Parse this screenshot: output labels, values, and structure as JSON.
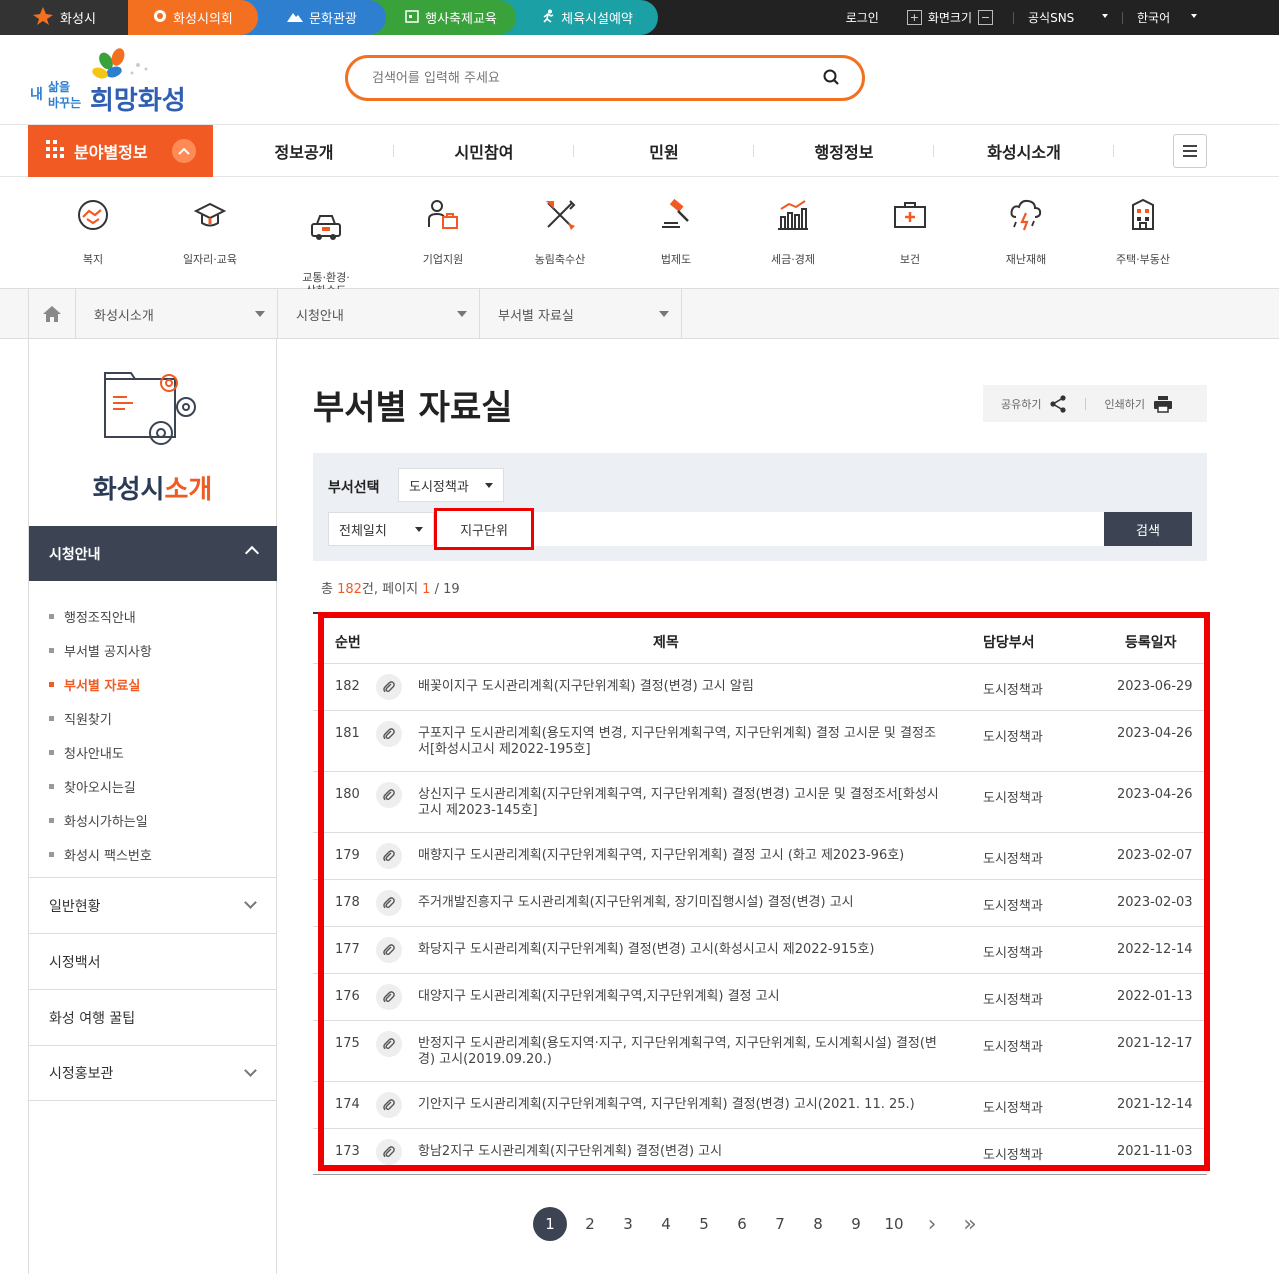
{
  "topbar": {
    "home": "화성시",
    "council": "화성시의회",
    "culture": "문화관광",
    "event": "행사축제교육",
    "sports": "체육시설예약",
    "login": "로그인",
    "zoom": "화면크기",
    "zoom_in": "+",
    "zoom_out": "−",
    "sns": "공식SNS",
    "lang": "한국어"
  },
  "header": {
    "logo_text": "내 삶을 바꾸는 희망화성",
    "search_placeholder": "검색어를 입력해 주세요"
  },
  "gnb": {
    "category_button": "분야별정보",
    "menus": [
      "정보공개",
      "시민참여",
      "민원",
      "행정정보",
      "화성시소개"
    ]
  },
  "categories": [
    {
      "label": "복지",
      "icon": "handshake-icon"
    },
    {
      "label": "일자리·교육",
      "icon": "graduation-cap-icon"
    },
    {
      "label": "교통·환경·\n상하수도",
      "icon": "car-icon"
    },
    {
      "label": "기업지원",
      "icon": "business-person-icon"
    },
    {
      "label": "농림축수산",
      "icon": "farming-tools-icon"
    },
    {
      "label": "법제도",
      "icon": "gavel-icon"
    },
    {
      "label": "세금·경제",
      "icon": "bar-chart-icon"
    },
    {
      "label": "보건",
      "icon": "first-aid-icon"
    },
    {
      "label": "재난재해",
      "icon": "storm-icon"
    },
    {
      "label": "주택·부동산",
      "icon": "building-icon"
    }
  ],
  "breadcrumb": [
    "화성시소개",
    "시청안내",
    "부서별 자료실"
  ],
  "sidebar": {
    "title_main": "화성시",
    "title_accent": "소개",
    "active_group": "시청안내",
    "sub_items": [
      "행정조직안내",
      "부서별 공지사항",
      "부서별 자료실",
      "직원찾기",
      "청사안내도",
      "찾아오시는길",
      "화성시가하는일",
      "화성시 팩스번호"
    ],
    "active_sub": "부서별 자료실",
    "groups": [
      "일반현황",
      "시정백서",
      "화성 여행 꿀팁",
      "시정홍보관"
    ]
  },
  "page": {
    "title": "부서별 자료실",
    "share": "공유하기",
    "print": "인쇄하기"
  },
  "search_form": {
    "dept_label": "부서선택",
    "dept_value": "도시정책과",
    "match_value": "전체일치",
    "keyword": "지구단위",
    "button": "검색"
  },
  "summary": {
    "prefix": "총 ",
    "total": "182",
    "mid": "건, 페이지 ",
    "page": "1",
    "suffix": " / 19"
  },
  "table": {
    "headers": [
      "순번",
      "제목",
      "담당부서",
      "등록일자"
    ],
    "rows": [
      {
        "no": "182",
        "title": "배꽃이지구 도시관리계획(지구단위계획) 결정(변경) 고시 알림",
        "dept": "도시정책과",
        "date": "2023-06-29"
      },
      {
        "no": "181",
        "title": "구포지구 도시관리계획(용도지역 변경, 지구단위계획구역, 지구단위계획) 결정 고시문 및 결정조서[화성시고시 제2022-195호]",
        "dept": "도시정책과",
        "date": "2023-04-26"
      },
      {
        "no": "180",
        "title": "상신지구 도시관리계획(지구단위계획구역, 지구단위계획) 결정(변경) 고시문 및 결정조서[화성시고시 제2023-145호]",
        "dept": "도시정책과",
        "date": "2023-04-26"
      },
      {
        "no": "179",
        "title": "매향지구 도시관리계획(지구단위계획구역, 지구단위계획) 결정 고시 (화고 제2023-96호)",
        "dept": "도시정책과",
        "date": "2023-02-07"
      },
      {
        "no": "178",
        "title": "주거개발진흥지구 도시관리계획(지구단위계획, 장기미집행시설) 결정(변경) 고시",
        "dept": "도시정책과",
        "date": "2023-02-03"
      },
      {
        "no": "177",
        "title": "화당지구 도시관리계획(지구단위계획) 결정(변경) 고시(화성시고시 제2022-915호)",
        "dept": "도시정책과",
        "date": "2022-12-14"
      },
      {
        "no": "176",
        "title": "대양지구 도시관리계획(지구단위계획구역,지구단위계획) 결정 고시",
        "dept": "도시정책과",
        "date": "2022-01-13"
      },
      {
        "no": "175",
        "title": "반정지구 도시관리계획(용도지역·지구, 지구단위계획구역, 지구단위계획, 도시계획시설) 결정(변경) 고시(2019.09.20.)",
        "dept": "도시정책과",
        "date": "2021-12-17"
      },
      {
        "no": "174",
        "title": "기안지구 도시관리계획(지구단위계획구역, 지구단위계획) 결정(변경) 고시(2021. 11. 25.)",
        "dept": "도시정책과",
        "date": "2021-12-14"
      },
      {
        "no": "173",
        "title": "항남2지구 도시관리계획(지구단위계획) 결정(변경) 고시",
        "dept": "도시정책과",
        "date": "2021-11-03"
      }
    ]
  },
  "paging": {
    "pages": [
      "1",
      "2",
      "3",
      "4",
      "5",
      "6",
      "7",
      "8",
      "9",
      "10"
    ],
    "current": "1",
    "next": "›",
    "last": "»"
  },
  "colors": {
    "accent": "#f15a22",
    "navy": "#3c4453",
    "highlight": "#e00000"
  }
}
